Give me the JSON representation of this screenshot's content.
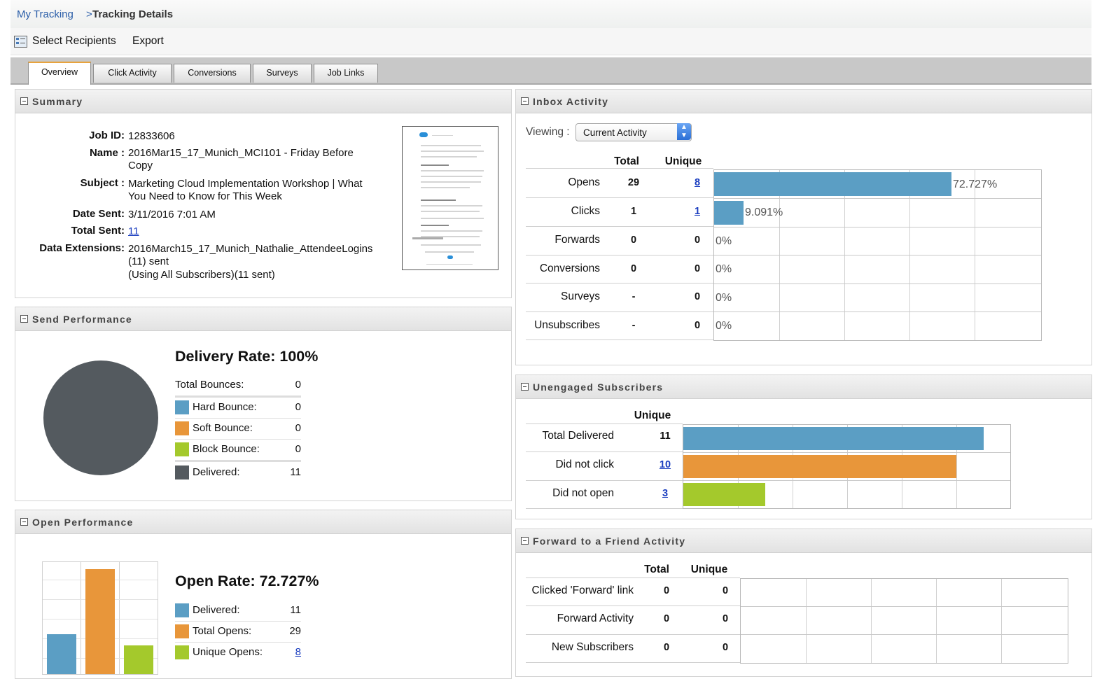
{
  "breadcrumb": {
    "parent": "My Tracking",
    "separator": ">",
    "current": "Tracking Details"
  },
  "toolbar": {
    "select_recipients": "Select Recipients",
    "export": "Export"
  },
  "tabs": [
    {
      "label": "Overview",
      "active": true
    },
    {
      "label": "Click Activity"
    },
    {
      "label": "Conversions"
    },
    {
      "label": "Surveys"
    },
    {
      "label": "Job Links"
    }
  ],
  "summary": {
    "title": "Summary",
    "job_id_label": "Job ID:",
    "job_id": "12833606",
    "name_label": "Name :",
    "name_line1": "2016Mar15_17_Munich_MCI101 - Friday Before",
    "name_line2": "Copy",
    "subject_label": "Subject :",
    "subject_line1": "Marketing Cloud Implementation Workshop | What",
    "subject_line2": "You Need to Know for This Week",
    "date_sent_label": "Date Sent:",
    "date_sent": "3/11/2016 7:01 AM",
    "total_sent_label": "Total Sent:",
    "total_sent": "11",
    "data_ext_label": "Data Extensions:",
    "data_ext_line1": "2016March15_17_Munich_Nathalie_AttendeeLogins",
    "data_ext_line2": "(11) sent",
    "data_ext_line3": "(Using All Subscribers)(11 sent)"
  },
  "send_performance": {
    "title": "Send Performance",
    "delivery_rate": "Delivery Rate: 100%",
    "rows": [
      {
        "label": "Total Bounces:",
        "value": "0",
        "color": ""
      },
      {
        "label": "Hard Bounce:",
        "value": "0",
        "color": "#5b9ec4"
      },
      {
        "label": "Soft Bounce:",
        "value": "0",
        "color": "#e8963a"
      },
      {
        "label": "Block Bounce:",
        "value": "0",
        "color": "#a4c92c"
      },
      {
        "label": "Delivered:",
        "value": "11",
        "color": "#545a5f"
      }
    ],
    "pie": {
      "delivered_fraction": 1.0,
      "color": "#545a5f"
    }
  },
  "open_performance": {
    "title": "Open Performance",
    "open_rate": "Open Rate: 72.727%",
    "rows": [
      {
        "label": "Delivered:",
        "value": "11",
        "color": "#5b9ec4",
        "link": false
      },
      {
        "label": "Total Opens:",
        "value": "29",
        "color": "#e8963a",
        "link": false
      },
      {
        "label": "Unique Opens:",
        "value": "8",
        "color": "#a4c92c",
        "link": true
      }
    ]
  },
  "inbox_activity": {
    "title": "Inbox Activity",
    "viewing_label": "Viewing :",
    "viewing_value": "Current Activity",
    "col_total": "Total",
    "col_unique": "Unique",
    "rows": [
      {
        "label": "Opens",
        "total": "29",
        "unique": "8",
        "unique_link": true,
        "pct": "72.727%",
        "fraction": 0.72727
      },
      {
        "label": "Clicks",
        "total": "1",
        "unique": "1",
        "unique_link": true,
        "pct": "9.091%",
        "fraction": 0.09091
      },
      {
        "label": "Forwards",
        "total": "0",
        "unique": "0",
        "unique_link": false,
        "pct": "0%",
        "fraction": 0
      },
      {
        "label": "Conversions",
        "total": "0",
        "unique": "0",
        "unique_link": false,
        "pct": "0%",
        "fraction": 0
      },
      {
        "label": "Surveys",
        "total": "-",
        "unique": "0",
        "unique_link": false,
        "pct": "0%",
        "fraction": 0
      },
      {
        "label": "Unsubscribes",
        "total": "-",
        "unique": "0",
        "unique_link": false,
        "pct": "0%",
        "fraction": 0
      }
    ],
    "bar_color": "#5b9ec4"
  },
  "unengaged": {
    "title": "Unengaged Subscribers",
    "col_unique": "Unique",
    "max": 11,
    "rows": [
      {
        "label": "Total Delivered",
        "value": "11",
        "link": false,
        "color": "#5b9ec4"
      },
      {
        "label": "Did not click",
        "value": "10",
        "link": true,
        "color": "#e8963a"
      },
      {
        "label": "Did not open",
        "value": "3",
        "link": true,
        "color": "#a4c92c"
      }
    ]
  },
  "forward_friend": {
    "title": "Forward to a Friend Activity",
    "col_total": "Total",
    "col_unique": "Unique",
    "rows": [
      {
        "label": "Clicked 'Forward' link",
        "total": "0",
        "unique": "0"
      },
      {
        "label": "Forward Activity",
        "total": "0",
        "unique": "0"
      },
      {
        "label": "New Subscribers",
        "total": "0",
        "unique": "0"
      }
    ]
  }
}
